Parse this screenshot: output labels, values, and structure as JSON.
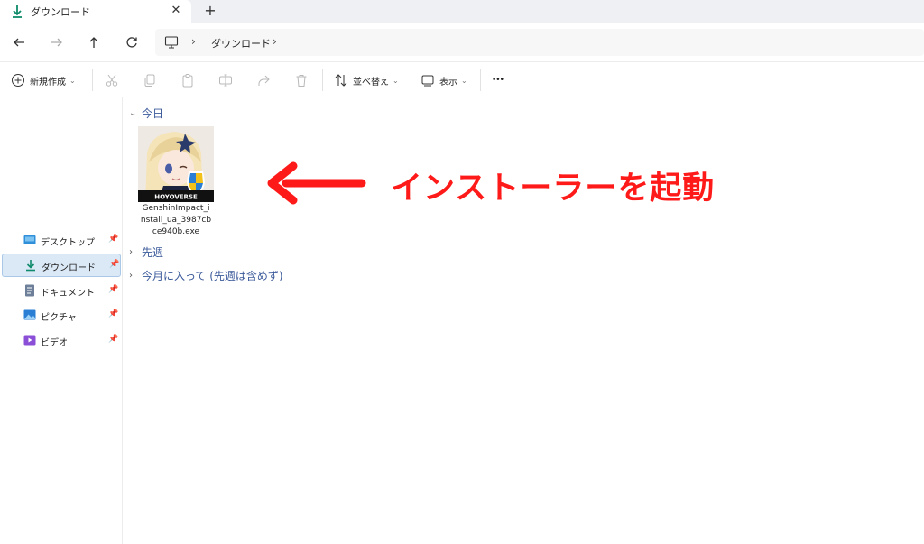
{
  "tab": {
    "title": "ダウンロード",
    "close_glyph": "✕",
    "new_tab_glyph": "+"
  },
  "address": {
    "path": [
      "ダウンロード"
    ]
  },
  "commandbar": {
    "new_label": "新規作成",
    "sort_label": "並べ替え",
    "view_label": "表示",
    "more_glyph": "•••"
  },
  "sidebar": {
    "items": [
      {
        "label": "デスクトップ",
        "icon": "desktop-icon"
      },
      {
        "label": "ダウンロード",
        "icon": "download-icon",
        "active": true
      },
      {
        "label": "ドキュメント",
        "icon": "document-icon"
      },
      {
        "label": "ピクチャ",
        "icon": "pictures-icon"
      },
      {
        "label": "ビデオ",
        "icon": "video-icon"
      }
    ]
  },
  "groups": {
    "today": "今日",
    "last_week": "先週",
    "this_month": "今月に入って (先週は含めず)"
  },
  "file": {
    "name_lines": [
      "GenshinImpact_i",
      "nstall_ua_3987cb",
      "ce940b.exe"
    ],
    "thumb_banner": "HOYOVERSE"
  },
  "annotation": {
    "text": "インストーラーを起動",
    "color": "#ff1a1a"
  },
  "colors": {
    "accent": "#0f8a6a",
    "group_header": "#3b5a9a",
    "selection": "#dbe9f7"
  }
}
